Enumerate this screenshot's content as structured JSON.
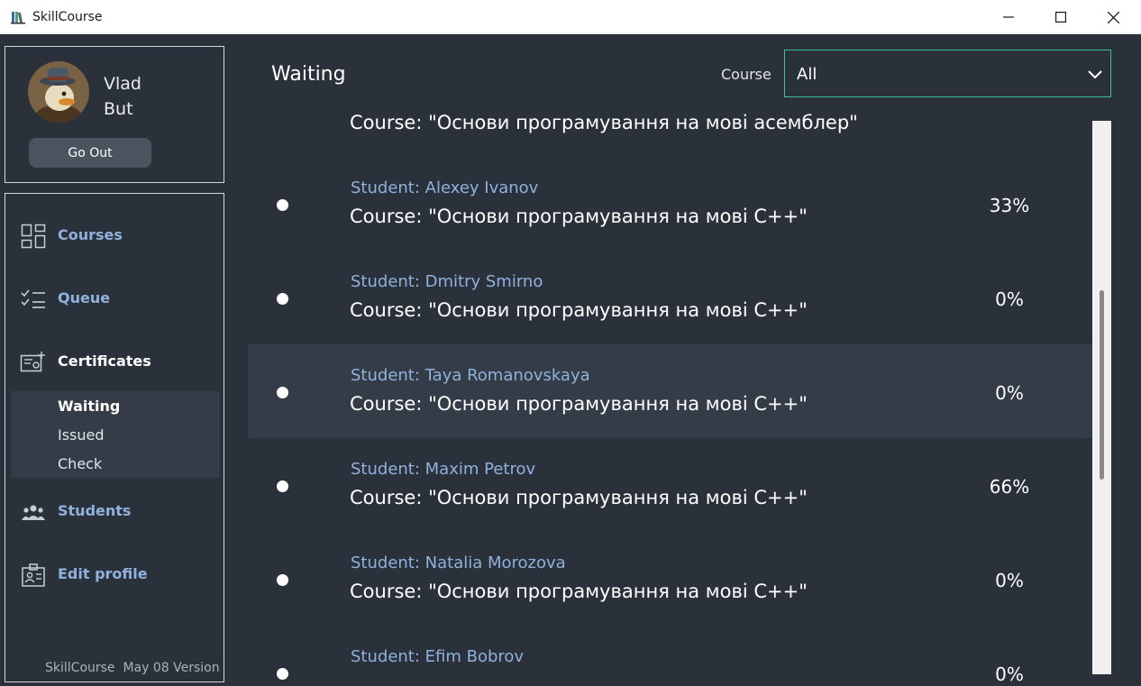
{
  "window": {
    "title": "SkillCourse",
    "minimize_icon": "minimize-icon",
    "maximize_icon": "maximize-icon",
    "close_icon": "close-icon"
  },
  "profile": {
    "first_name": "Vlad",
    "last_name": "But",
    "logout_label": "Go Out"
  },
  "nav": {
    "courses": "Courses",
    "queue": "Queue",
    "certificates": "Certificates",
    "students": "Students",
    "edit_profile": "Edit profile",
    "certificates_sub": [
      "Waiting",
      "Issued",
      "Check"
    ],
    "version": "SkillCourse  May 08 Version"
  },
  "header": {
    "title": "Waiting",
    "course_label": "Course",
    "course_value": "All"
  },
  "list": {
    "partial_top_course": "Course: \"Основи програмування на мові асемблер\"",
    "rows": [
      {
        "student": "Student: Alexey Ivanov",
        "course": "Course: \"Основи програмування на мові С++\"",
        "percent": "33%"
      },
      {
        "student": "Student: Dmitry Smirno",
        "course": "Course: \"Основи програмування на мові С++\"",
        "percent": "0%"
      },
      {
        "student": "Student: Taya Romanovskaya",
        "course": "Course: \"Основи програмування на мові С++\"",
        "percent": "0%"
      },
      {
        "student": "Student: Maxim Petrov",
        "course": "Course: \"Основи програмування на мові С++\"",
        "percent": "66%"
      },
      {
        "student": "Student: Natalia Morozova",
        "course": "Course: \"Основи програмування на мові С++\"",
        "percent": "0%"
      },
      {
        "student": "Student: Efim Bobrov",
        "course": "",
        "percent": "0%"
      }
    ]
  },
  "colors": {
    "background": "#2b313b",
    "accent_link": "#8fb1dc",
    "select_border": "#3fbfa0",
    "highlight_row": "#343c47"
  }
}
